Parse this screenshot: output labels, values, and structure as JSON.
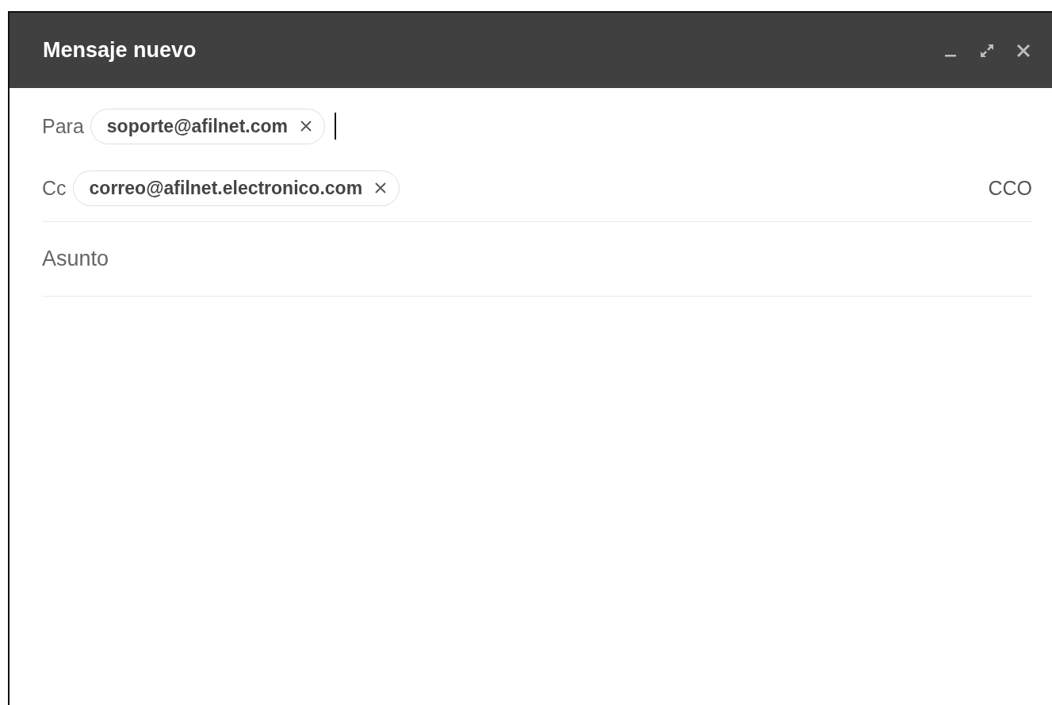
{
  "window": {
    "title": "Mensaje nuevo"
  },
  "recipients": [
    {
      "label": "Para",
      "chips": [
        "soporte@afilnet.com"
      ],
      "focused": true
    },
    {
      "label": "Cc",
      "chips": [
        "correo@afilnet.electronico.com"
      ],
      "focused": false,
      "extra_link": "CCO"
    }
  ],
  "subject": {
    "placeholder": "Asunto"
  }
}
